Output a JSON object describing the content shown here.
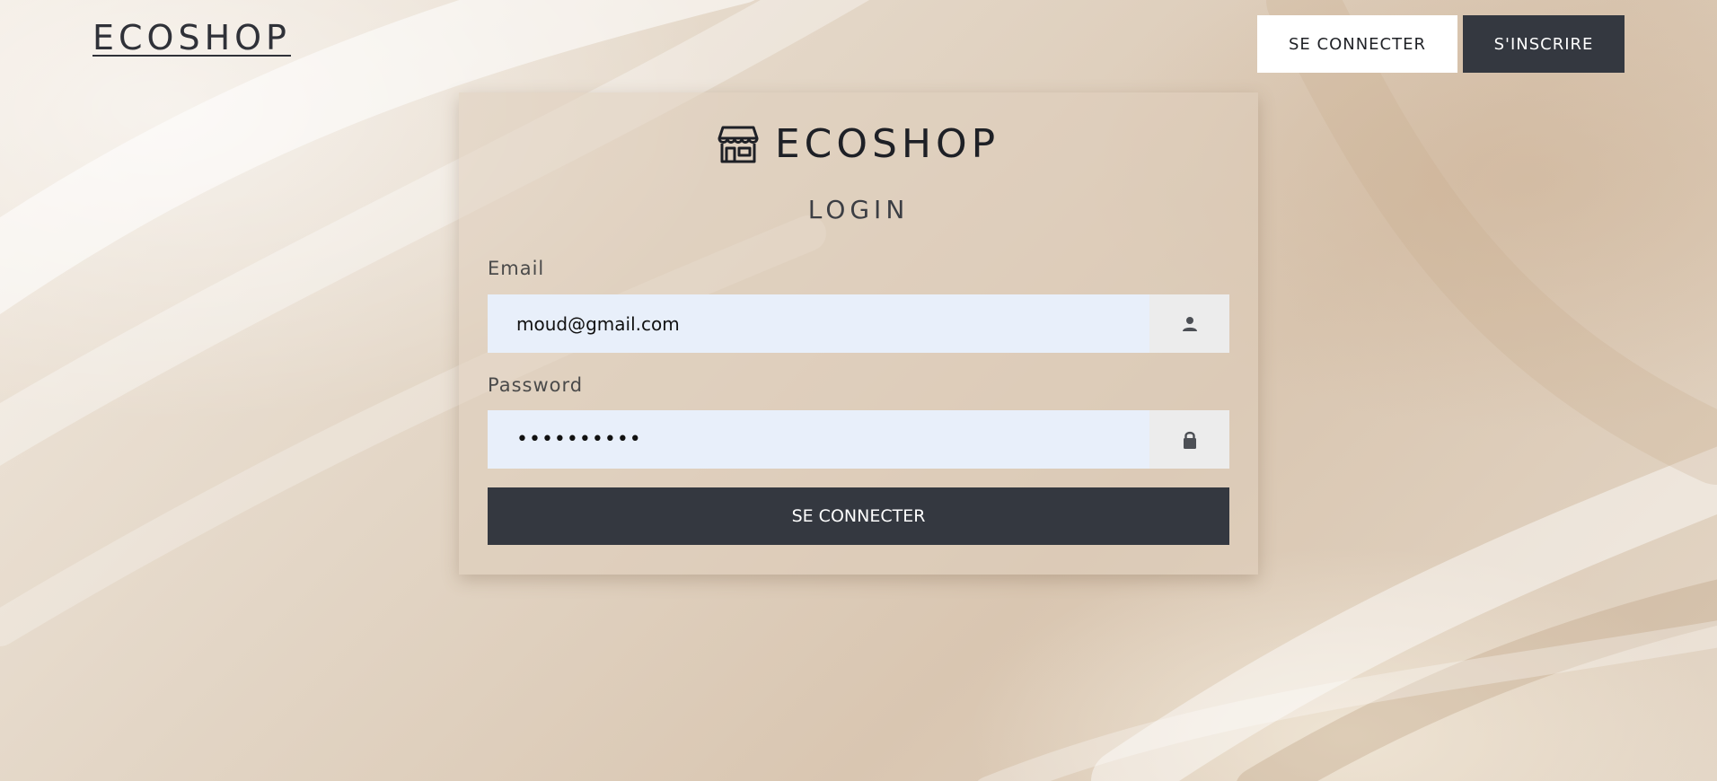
{
  "header": {
    "logo": "ECOSHOP",
    "nav": {
      "login_label": "SE CONNECTER",
      "signup_label": "S'INSCRIRE"
    }
  },
  "login_card": {
    "brand_text": "ECOSHOP",
    "brand_icon": "store-icon",
    "heading": "LOGIN",
    "email": {
      "label": "Email",
      "value": "moud@gmail.com",
      "icon": "user-icon"
    },
    "password": {
      "label": "Password",
      "masked_value": "••••••••••",
      "icon": "lock-icon"
    },
    "submit_label": "SE CONNECTER"
  },
  "colors": {
    "dark_button": "#343840",
    "input_background": "#e8effa",
    "addon_background": "#ececec"
  }
}
